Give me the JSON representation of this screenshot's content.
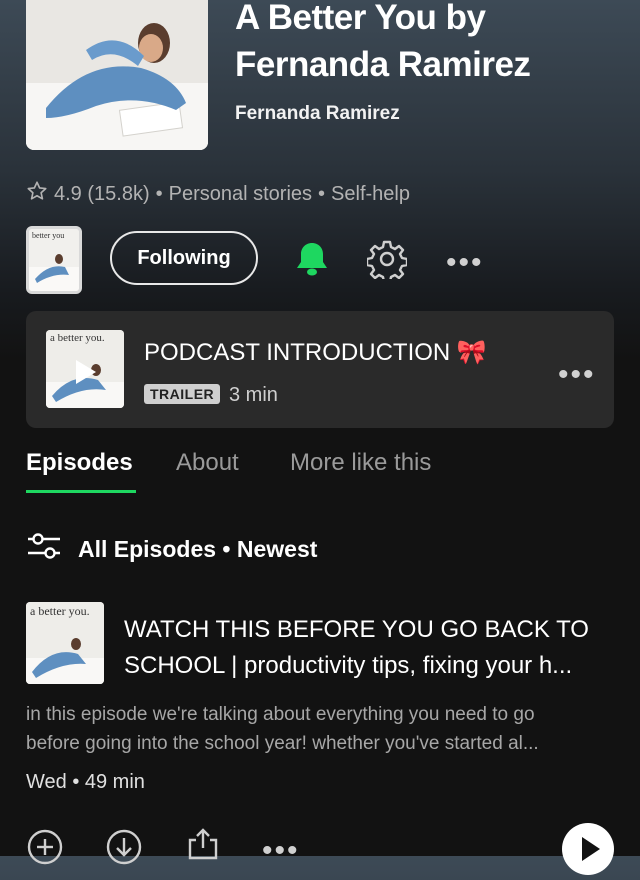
{
  "podcast": {
    "title_line1": "A Better You by",
    "title_line2": "Fernanda Ramirez",
    "author": "Fernanda Ramirez",
    "rating": "4.9 (15.8k)",
    "category1": "Personal stories",
    "category2": "Self-help",
    "separator": "•",
    "cover_text": "better you"
  },
  "actions": {
    "follow_label": "Following",
    "accent_color": "#1ed760"
  },
  "trailer": {
    "thumb_text": "a better you.",
    "title": "PODCAST INTRODUCTION 🎀",
    "badge": "TRAILER",
    "duration": "3 min"
  },
  "tabs": [
    {
      "label": "Episodes",
      "active": true
    },
    {
      "label": "About",
      "active": false
    },
    {
      "label": "More like this",
      "active": false
    }
  ],
  "filter": {
    "label": "All Episodes • Newest"
  },
  "episode": {
    "thumb_text": "a better you.",
    "title_line1": "WATCH THIS BEFORE YOU GO BACK TO",
    "title_line2": "SCHOOL | productivity tips, fixing your h...",
    "desc_line1": "in this episode we're talking about everything you need to go",
    "desc_line2": "before going into the school year! whether you've started al...",
    "date_duration": "Wed • 49 min"
  },
  "icons": {
    "star": "star-icon",
    "bell": "bell-icon",
    "gear": "gear-icon",
    "more": "more-icon",
    "filter": "filter-icon",
    "play": "play-icon",
    "add": "add-icon",
    "download": "download-icon",
    "share": "share-icon"
  }
}
